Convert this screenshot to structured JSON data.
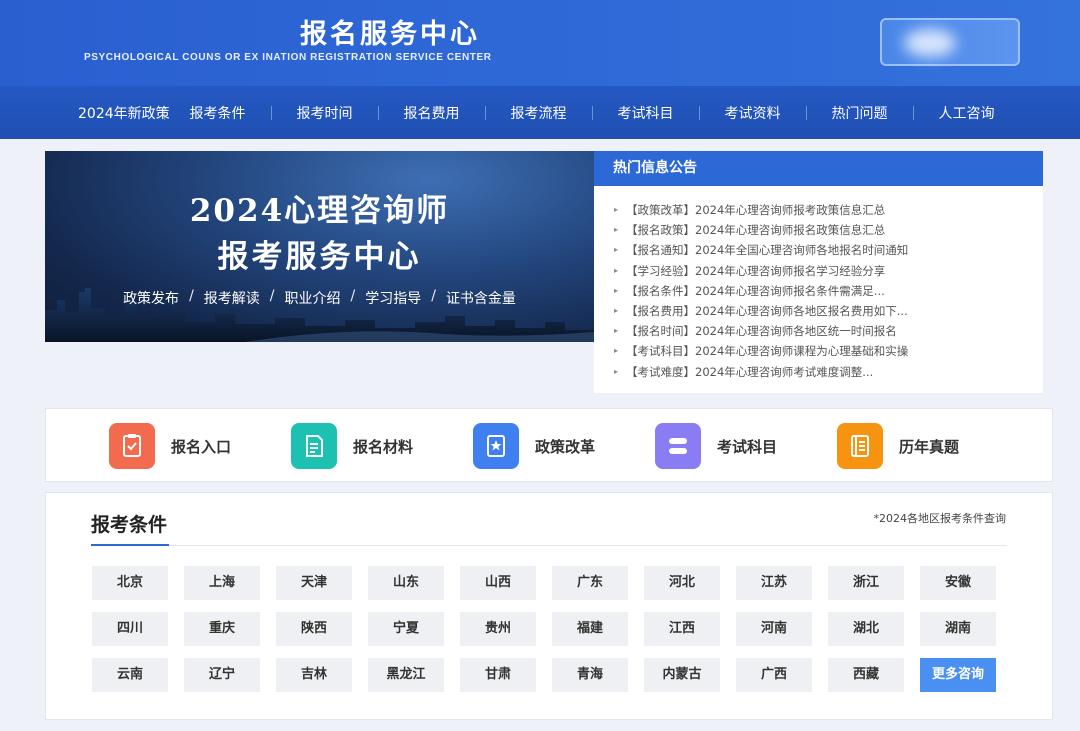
{
  "header": {
    "title": "报名服务中心",
    "subtitle": "PSYCHOLOGICAL COUNS   OR EX   INATION REGISTRATION SERVICE CENTER"
  },
  "nav": {
    "items": [
      "2024年新政策",
      "报考条件",
      "报考时间",
      "报名费用",
      "报考流程",
      "考试科目",
      "考试资料",
      "热门问题",
      "人工咨询"
    ]
  },
  "banner": {
    "line1": "2024心理咨询师",
    "line2": "报考服务中心",
    "tags": [
      "政策发布",
      "报考解读",
      "职业介绍",
      "学习指导",
      "证书含金量"
    ],
    "separator": "/"
  },
  "notice": {
    "title": "热门信息公告",
    "items": [
      {
        "tag": "【政策改革】",
        "text": "2024年心理咨询师报考政策信息汇总"
      },
      {
        "tag": "【报名政策】",
        "text": "2024年心理咨询师报名政策信息汇总"
      },
      {
        "tag": "【报名通知】",
        "text": "2024年全国心理咨询师各地报名时间通知"
      },
      {
        "tag": "【学习经验】",
        "text": "2024年心理咨询师报名学习经验分享"
      },
      {
        "tag": "【报名条件】",
        "text": "2024年心理咨询师报名条件需满足..."
      },
      {
        "tag": "【报名费用】",
        "text": "2024年心理咨询师各地区报名费用如下..."
      },
      {
        "tag": "【报名时间】",
        "text": "2024年心理咨询师各地区统一时间报名"
      },
      {
        "tag": "【考试科目】",
        "text": "2024年心理咨询师课程为心理基础和实操"
      },
      {
        "tag": "【考试难度】",
        "text": "2024年心理咨询师考试难度调整..."
      }
    ]
  },
  "quick": {
    "items": [
      {
        "label": "报名入口",
        "icon": "checklist-icon",
        "color": "#f26b4f"
      },
      {
        "label": "报名材料",
        "icon": "document-icon",
        "color": "#1cc1b2"
      },
      {
        "label": "政策改革",
        "icon": "star-book-icon",
        "color": "#3f7ff0"
      },
      {
        "label": "考试科目",
        "icon": "stack-icon",
        "color": "#8a7cf3"
      },
      {
        "label": "历年真题",
        "icon": "list-document-icon",
        "color": "#f69310"
      }
    ]
  },
  "conditions": {
    "title": "报考条件",
    "note": "*2024各地区报考条件查询",
    "regions": [
      "北京",
      "上海",
      "天津",
      "山东",
      "山西",
      "广东",
      "河北",
      "江苏",
      "浙江",
      "安徽",
      "四川",
      "重庆",
      "陕西",
      "宁夏",
      "贵州",
      "福建",
      "江西",
      "河南",
      "湖北",
      "湖南",
      "云南",
      "辽宁",
      "吉林",
      "黑龙江",
      "甘肃",
      "青海",
      "内蒙古",
      "广西",
      "西藏",
      "更多咨询"
    ]
  }
}
